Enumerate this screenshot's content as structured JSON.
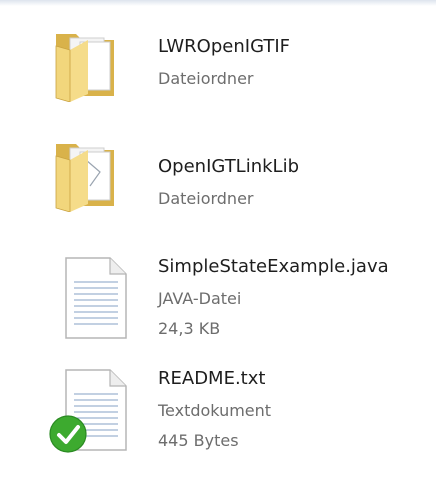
{
  "files": [
    {
      "name": "LWROpenIGTIF",
      "type": "Dateiordner",
      "icon": "folder-icon"
    },
    {
      "name": "OpenIGTLinkLib",
      "type": "Dateiordner",
      "icon": "folder-icon"
    },
    {
      "name": "SimpleStateExample.java",
      "type": "JAVA-Datei",
      "size": "24,3 KB",
      "icon": "text-document-icon"
    },
    {
      "name": "README.txt",
      "type": "Textdokument",
      "size": "445 Bytes",
      "icon": "text-document-icon",
      "overlay_icon": "checkmark-icon"
    }
  ],
  "colors": {
    "folder": "#f2d67c",
    "folder_dark": "#d9b24a",
    "check": "#3daa2f",
    "meta_text": "#6d6d6d"
  }
}
